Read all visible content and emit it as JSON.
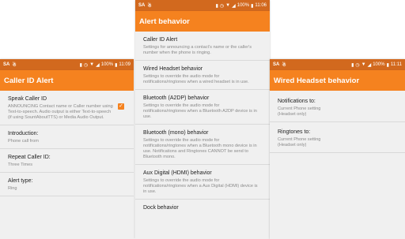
{
  "status_left": [
    "SA",
    "☃"
  ],
  "screens": {
    "caller_id": {
      "battery": "100%",
      "time": "11:09",
      "title": "Caller ID Alert",
      "items": [
        {
          "title": "Speak Caller ID",
          "summary": "ANNOUNCING Contact name or Caller number using Text-to-speech. Audio output is either Text-to-speech (if using SountAboutTTS) or Media Audio Output.",
          "checked": true
        },
        {
          "title": "Introduction:",
          "summary": "Phone call from"
        },
        {
          "title": "Repeat Caller ID:",
          "summary": "Three Times"
        },
        {
          "title": "Alert type:",
          "summary": "Ring"
        }
      ]
    },
    "alert_behavior": {
      "battery": "100%",
      "time": "11:06",
      "title": "Alert behavior",
      "items": [
        {
          "title": "Caller ID Alert",
          "summary": "Settings for announcing a contact's name or the caller's number when the phone is ringing."
        },
        {
          "title": "Wired Headset behavior",
          "summary": "Settings to override the audio mode for notifications/ringtones when a wired headset is in use."
        },
        {
          "title": "Bluetooth (A2DP) behavior",
          "summary": "Settings to override the audio mode for notifications/ringtones when a Bluetooth A2DP device is in use."
        },
        {
          "title": "Bluetooth (mono) behavior",
          "summary": "Settings to override the audio mode for notifications/ringtones when a Bluetooth mono device is in use. Notifications and Ringtones CANNOT be send to Bluetooth mono."
        },
        {
          "title": "Aux Digital (HDMI) behavior",
          "summary": "Settings to override the audio mode for notifications/ringtones when a Aux Digital (HDMI) device is in use."
        },
        {
          "title": "Dock behavior",
          "summary": ""
        }
      ]
    },
    "wired_headset": {
      "battery": "100%",
      "time": "11:11",
      "title": "Wired Headset behavior",
      "items": [
        {
          "title": "Notifications to:",
          "summary": "Current Phone setting (Headset only)"
        },
        {
          "title": "Ringtones to:",
          "summary": "Current Phone setting (Headset only)"
        }
      ]
    }
  },
  "colors": {
    "accent": "#f5821f",
    "status_bar": "#d2691e"
  }
}
